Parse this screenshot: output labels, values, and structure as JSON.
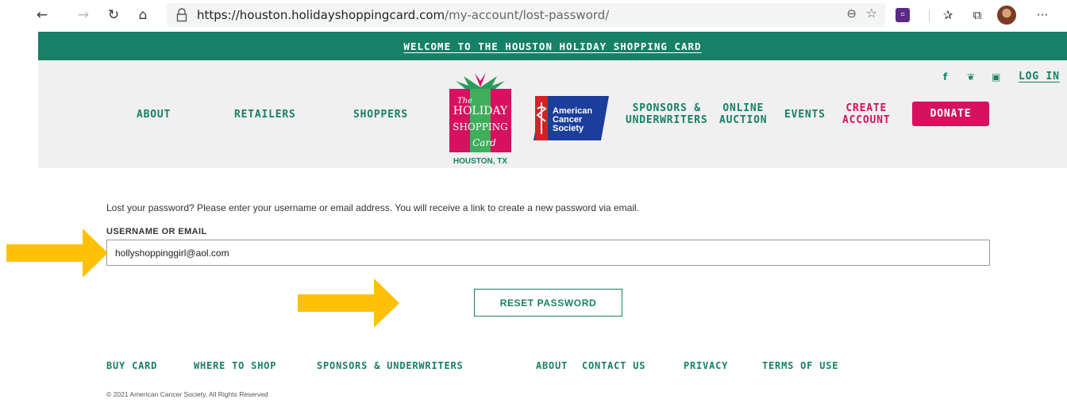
{
  "browser": {
    "url_host": "https://houston.holidayshoppingcard.com",
    "url_path": "/my-account/lost-password/",
    "back_icon": "←",
    "forward_icon": "→",
    "refresh_icon": "↻",
    "home_icon": "⌂",
    "zoom_icon": "⊖",
    "star_icon": "☆",
    "favorites_icon": "✰",
    "collections_icon": "⧉",
    "menu_icon": "···"
  },
  "site": {
    "welcome": "WELCOME TO THE HOUSTON HOLIDAY SHOPPING CARD",
    "nav": {
      "about": "ABOUT",
      "retailers": "RETAILERS",
      "shoppers": "SHOPPERS",
      "sponsors": [
        "SPONSORS &",
        "UNDERWRITERS"
      ],
      "online_auction": [
        "ONLINE",
        "AUCTION"
      ],
      "events": "EVENTS",
      "create_account": [
        "CREATE",
        "ACCOUNT"
      ],
      "donate": "DONATE",
      "login": "LOG IN"
    },
    "social": {
      "facebook": "f",
      "twitter": "❦",
      "instagram": "▣"
    },
    "logo": {
      "the": "The",
      "holiday": "HOLIDAY",
      "shopping": "SHOPPING",
      "card": "Card",
      "location": "HOUSTON, TX"
    },
    "acs_logo": [
      "American",
      "Cancer",
      "Society"
    ]
  },
  "form": {
    "intro": "Lost your password? Please enter your username or email address. You will receive a link to create a new password via email.",
    "label": "USERNAME OR EMAIL",
    "value": "hollyshoppinggirl@aol.com",
    "submit": "RESET PASSWORD"
  },
  "footer": {
    "links": [
      "BUY CARD",
      "WHERE TO SHOP",
      "SPONSORS & UNDERWRITERS",
      "ABOUT",
      "CONTACT US",
      "PRIVACY",
      "TERMS OF USE"
    ],
    "copyright": "© 2021 American Cancer Society, All Rights Reserved"
  },
  "colors": {
    "brand_green": "#178066",
    "brand_pink": "#d6115f",
    "arrow_yellow": "#ffc107"
  }
}
